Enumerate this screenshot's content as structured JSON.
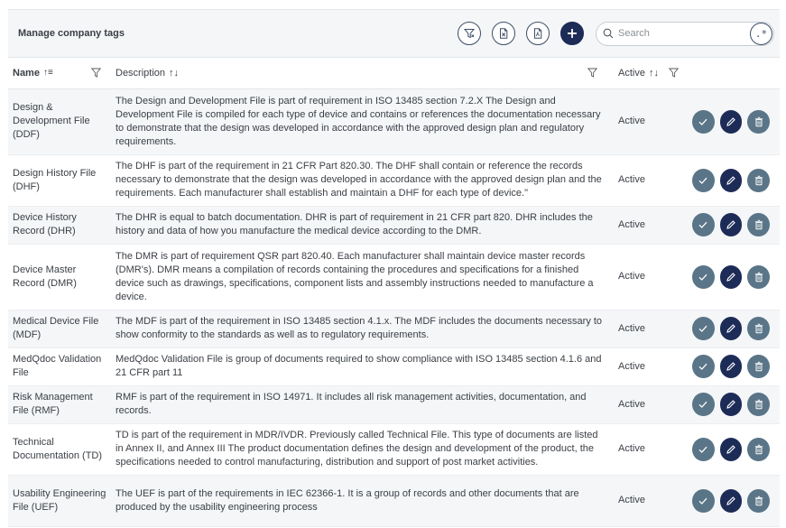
{
  "header": {
    "title": "Manage company tags",
    "search_placeholder": "Search",
    "search_value": "",
    "regex_label": ".*"
  },
  "columns": {
    "name": "Name",
    "description": "Description",
    "active": "Active"
  },
  "rows": [
    {
      "name": "Design & Development File (DDF)",
      "description": "The Design and Development File is part of requirement in ISO 13485 section 7.2.X The Design and Development File is compiled for each type of device and contains or references the documentation necessary to demonstrate that the design was developed in accordance with the approved design plan and regulatory requirements.",
      "status": "Active",
      "h": 73
    },
    {
      "name": "Design History File (DHF)",
      "description": "The DHF is part of the requirement in 21 CFR Part 820.30. The DHF shall contain or reference the records necessary to demonstrate that the design was developed in accordance with the approved design plan and the requirements. Each manufacturer shall establish and maintain a DHF for each type of device.\"",
      "status": "Active",
      "h": 57
    },
    {
      "name": "Device History Record (DHR)",
      "description": "The DHR is equal to batch documentation. DHR is part of requirement in 21 CFR part 820. DHR includes the history and data of how you manufacture the medical device according to the DMR.",
      "status": "Active",
      "h": 42
    },
    {
      "name": "Device Master Record (DMR)",
      "description": "The DMR is part of requirement QSR part 820.40. Each manufacturer shall maintain device master records (DMR's). DMR means a compilation of records containing the procedures and specifications for a finished device such as drawings, specifications, component lists and assembly instructions needed to manufacture a device.",
      "status": "Active",
      "h": 73
    },
    {
      "name": "Medical Device File (MDF)",
      "description": "The MDF is part of the requirement in ISO 13485 section 4.1.x. The MDF includes the documents necessary to show conformity to the standards as well as to regulatory requirements.",
      "status": "Active",
      "h": 42
    },
    {
      "name": "MedQdoc Validation File",
      "description": "MedQdoc Validation File is group of documents required to show compliance with ISO 13485 section 4.1.6 and 21 CFR part 11",
      "status": "Active",
      "h": 42
    },
    {
      "name": "Risk Management File (RMF)",
      "description": "RMF is part of the requirement in ISO 14971. It includes all risk management activities, documentation, and records.",
      "status": "Active",
      "h": 42
    },
    {
      "name": "Technical Documentation (TD)",
      "description": "TD is part of the requirement in MDR/IVDR. Previously called Technical File. This type of documents are listed in Annex II, and Annex III The product documentation defines the design and development of the product, the specifications needed to control manufacturing, distribution and support of post market activities.",
      "status": "Active",
      "h": 57
    },
    {
      "name": "Usability Engineering File (UEF)",
      "description": "The UEF is part of the requirements in IEC 62366-1. It is a group of records and other documents that are produced by the usability engineering process",
      "status": "Active",
      "h": 57
    }
  ],
  "colors": {
    "primary": "#1d2b57",
    "action_grey": "#5a7587",
    "row_stripe": "#f4f6f8"
  },
  "icons": {
    "clear_filter": "filter-clear-icon",
    "export_csv": "export-csv-icon",
    "export_pdf": "export-pdf-icon",
    "add": "plus-icon",
    "search": "search-icon",
    "approve": "check-icon",
    "edit": "pencil-icon",
    "delete": "trash-icon"
  }
}
